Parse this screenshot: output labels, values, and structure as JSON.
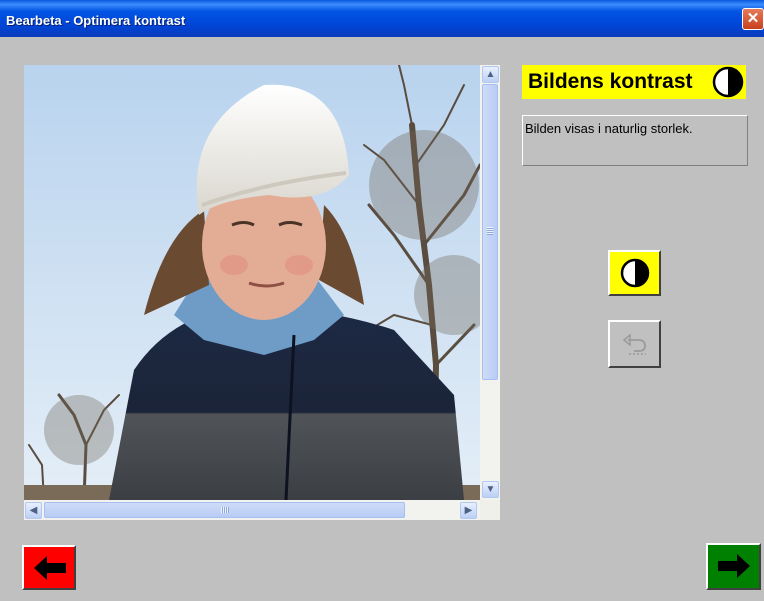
{
  "window": {
    "title": "Bearbeta - Optimera kontrast",
    "close_glyph": "✕"
  },
  "panel": {
    "heading": "Bildens kontrast",
    "heading_icon": "contrast-icon",
    "info_text": "Bilden visas i naturlig storlek."
  },
  "image_view": {
    "photo_icon": "photo-girl-white-hat",
    "scroll_up": "▲",
    "scroll_down": "▼",
    "scroll_left": "◀",
    "scroll_right": "▶"
  },
  "buttons": {
    "contrast_icon": "contrast-icon",
    "undo_icon": "undo-icon",
    "back_icon": "arrow-left-icon",
    "next_icon": "arrow-right-icon"
  },
  "colors": {
    "accent_yellow": "#ffff00",
    "back_red": "#ff0000",
    "next_green": "#008000",
    "titlebar_blue": "#0054e3",
    "window_gray": "#c0c0c0"
  }
}
